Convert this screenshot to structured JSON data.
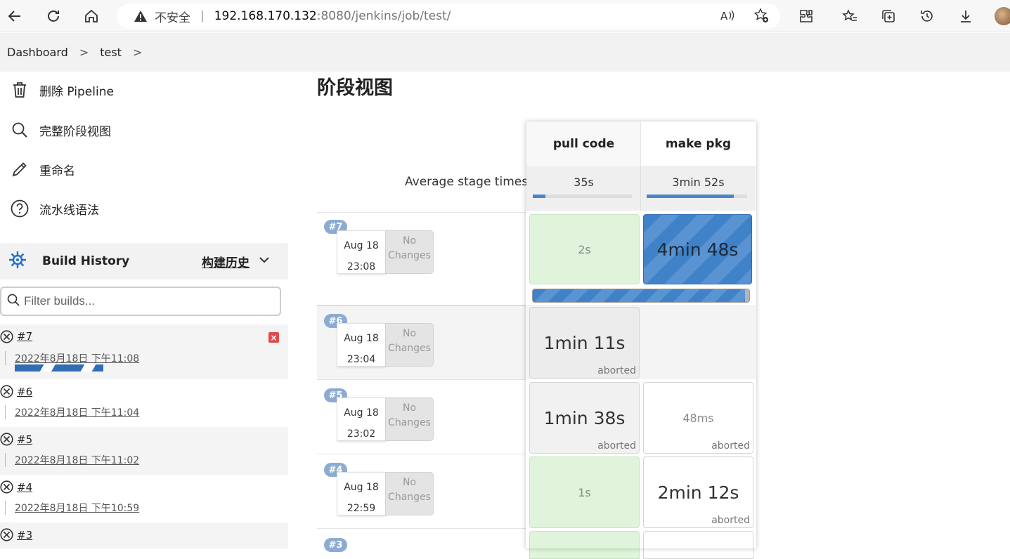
{
  "browser": {
    "insecure_label": "不安全",
    "url_host": "192.168.170.132",
    "url_rest": ":8080/jenkins/job/test/"
  },
  "breadcrumb": {
    "dashboard": "Dashboard",
    "job": "test"
  },
  "sidebar": {
    "tasks": [
      {
        "label": "删除 Pipeline",
        "icon": "trash-icon"
      },
      {
        "label": "完整阶段视图",
        "icon": "search-icon"
      },
      {
        "label": "重命名",
        "icon": "pencil-icon"
      },
      {
        "label": "流水线语法",
        "icon": "help-icon"
      }
    ],
    "build_history": {
      "title": "Build History",
      "trend_label": "构建历史",
      "filter_placeholder": "Filter builds..."
    },
    "builds": [
      {
        "number": "#7",
        "time": "2022年8月18日 下午11:08",
        "running": true
      },
      {
        "number": "#6",
        "time": "2022年8月18日 下午11:04"
      },
      {
        "number": "#5",
        "time": "2022年8月18日 下午11:02"
      },
      {
        "number": "#4",
        "time": "2022年8月18日 下午10:59"
      },
      {
        "number": "#3",
        "time": ""
      }
    ]
  },
  "stage_view": {
    "title": "阶段视图",
    "avg_label": "Average stage times:",
    "stages": [
      {
        "name": "pull code",
        "avg": "35s",
        "avg_fraction": 0.13
      },
      {
        "name": "make pkg",
        "avg": "3min 52s",
        "avg_fraction": 0.87
      }
    ],
    "no_changes": "No Changes",
    "aborted_label": "aborted",
    "runs": [
      {
        "badge": "#7",
        "date": "Aug 18",
        "time": "23:08",
        "cells": [
          "2s",
          "4min 48s"
        ]
      },
      {
        "badge": "#6",
        "date": "Aug 18",
        "time": "23:04",
        "cells": [
          "1min 11s",
          ""
        ]
      },
      {
        "badge": "#5",
        "date": "Aug 18",
        "time": "23:02",
        "cells": [
          "1min 38s",
          "48ms"
        ]
      },
      {
        "badge": "#4",
        "date": "Aug 18",
        "time": "22:59",
        "cells": [
          "1s",
          "2min 12s"
        ]
      },
      {
        "badge": "#3",
        "date": "",
        "time": "",
        "cells": [
          "",
          ""
        ]
      }
    ]
  }
}
